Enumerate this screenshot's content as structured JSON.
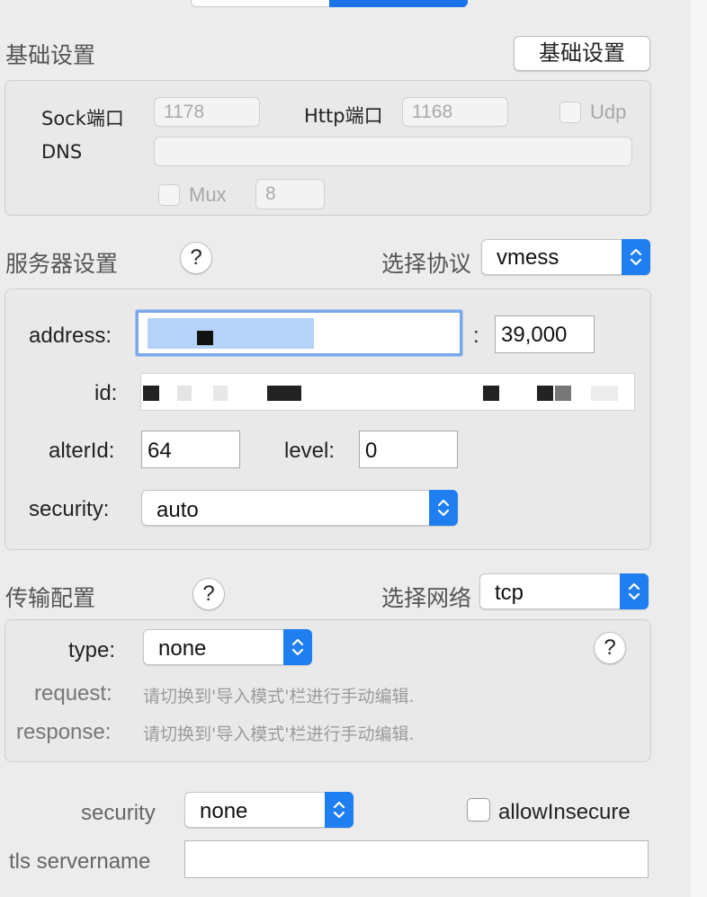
{
  "basic": {
    "title": "基础设置",
    "button": "基础设置",
    "sock_label": "Sock端口",
    "sock_value": "1178",
    "http_label": "Http端口",
    "http_value": "1168",
    "udp_label": "Udp",
    "dns_label": "DNS",
    "dns_value": "",
    "mux_label": "Mux",
    "mux_value": "8"
  },
  "server": {
    "title": "服务器设置",
    "help": "?",
    "protocol_label": "选择协议",
    "protocol_value": "vmess",
    "address_label": "address:",
    "address_value": "",
    "port_sep": ":",
    "port_value": "39,000",
    "id_label": "id:",
    "id_value": "",
    "alterid_label": "alterId:",
    "alterid_value": "64",
    "level_label": "level:",
    "level_value": "0",
    "security_label": "security:",
    "security_value": "auto"
  },
  "transport": {
    "title": "传输配置",
    "help": "?",
    "network_label": "选择网络",
    "network_value": "tcp",
    "type_label": "type:",
    "type_value": "none",
    "type_help": "?",
    "request_label": "request:",
    "request_hint": "请切换到'导入模式'栏进行手动编辑.",
    "response_label": "response:",
    "response_hint": "请切换到'导入模式'栏进行手动编辑."
  },
  "tls": {
    "security_label": "security",
    "security_value": "none",
    "allow_insecure_label": "allowInsecure",
    "servername_label": "tls servername",
    "servername_value": ""
  },
  "colors": {
    "accent": "#1f7ef0",
    "focus_ring": "#7aa7e8"
  },
  "icons": {
    "popup_arrows": "chevron-up-down-icon",
    "help": "question-mark-icon"
  }
}
